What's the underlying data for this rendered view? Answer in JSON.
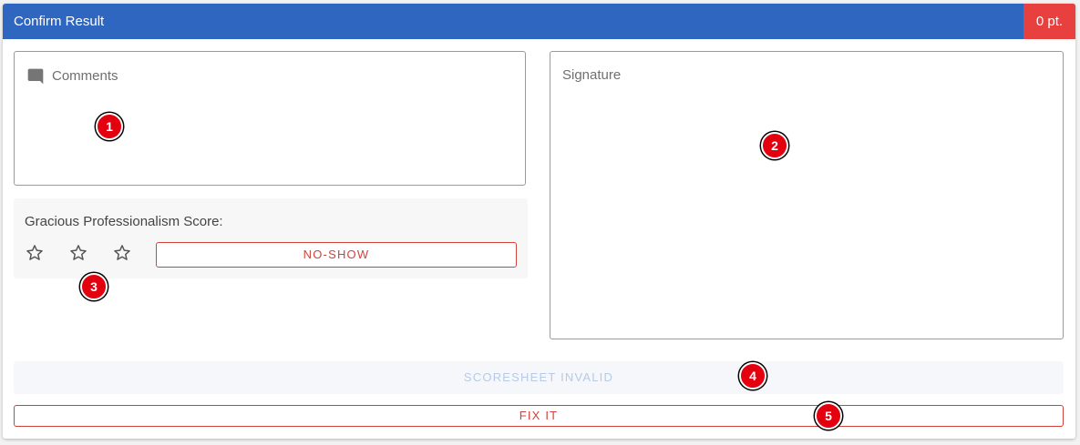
{
  "header": {
    "title": "Confirm Result",
    "points": "0 pt."
  },
  "comments": {
    "icon": "comment-icon",
    "label": "Comments"
  },
  "signature": {
    "label": "Signature"
  },
  "gracious_professionalism": {
    "label": "Gracious Professionalism Score:",
    "stars": [
      "star-outline-icon",
      "star-outline-icon",
      "star-outline-icon"
    ],
    "rating": 0,
    "no_show_label": "NO-SHOW"
  },
  "status": {
    "invalid_label": "SCORESHEET INVALID"
  },
  "actions": {
    "fix_label": "FIX IT"
  },
  "markers": [
    "1",
    "2",
    "3",
    "4",
    "5"
  ],
  "colors": {
    "header": "#2e66c0",
    "badge": "#e8403f",
    "accent_red": "#d0433c",
    "marker": "#e3000f"
  }
}
